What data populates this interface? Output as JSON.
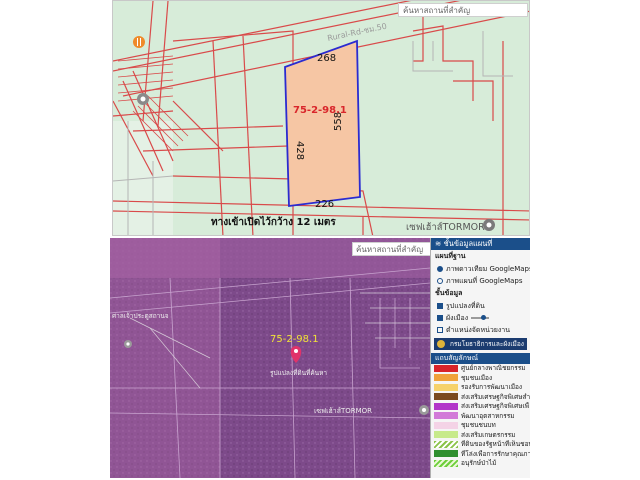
{
  "top_map": {
    "search_placeholder": "ค้นหาสถานที่สำคัญ",
    "road_label": "Rural-Rd-ชม.50",
    "parcel_id": "75-2-98.1",
    "side_top": "268",
    "side_left": "428",
    "side_right": "558",
    "side_bottom": "226",
    "access_note": "ทางเข้าเปิดไว้กว้าง 12 เมตร",
    "poi_label": "เซฟเฮ้าส์TORMOR",
    "colors": {
      "map_bg": "#d7ecd9",
      "parcel_fill": "#f6c6a4",
      "parcel_stroke": "#2b2bd0",
      "road_line": "#d94a4a"
    }
  },
  "bottom_map": {
    "search_placeholder": "ค้นหาสถานที่สำคัญ",
    "parcel_id": "75-2-98.1",
    "pin_label": "รูปแปลงที่ดินที่ค้นหา",
    "poi_label": "เซฟเฮ้าส์TORMOR",
    "left_poi_label": "ศาลเจ้าประตูสถานจ"
  },
  "panel": {
    "header": "ชั้นข้อมูลแผนที่",
    "basemap_title": "แผนที่ฐาน",
    "basemap_options": [
      "ภาพดาวเทียม GoogleMaps",
      "ภาพแผนที่ GoogleMaps"
    ],
    "layers_title": "ชั้นข้อมูล",
    "layers": [
      "รูปแปลงที่ดิน",
      "ผังเมือง",
      "ตำแหน่งจัดหน่วยงาน"
    ],
    "org_name": "กรมโยธาธิการและผังเมือง",
    "legend_title": "แถบสัญลักษณ์",
    "legend": [
      {
        "label": "ศูนย์กลางพาณิชยกรรม",
        "color": "#d8232a"
      },
      {
        "label": "ชุมชนเมือง",
        "color": "#f0a23a"
      },
      {
        "label": "รองรับการพัฒนาเมือง",
        "color": "#f6d26b"
      },
      {
        "label": "ส่งเสริมเศรษฐกิจพิเศษสำห",
        "color": "#7b4a1e"
      },
      {
        "label": "ส่งเสริมเศรษฐกิจพิเศษเพื่",
        "color": "#b235c9"
      },
      {
        "label": "พัฒนาอุตสาหกรรม",
        "color": "#d27ad8"
      },
      {
        "label": "ชุมชนชนบท",
        "color": "#f4d3e6"
      },
      {
        "label": "ส่งเสริมเกษตรกรรม",
        "color": "#c7ea8b"
      },
      {
        "label": "ที่ดินของรัฐหน้าที่เห็นชอบให้เป",
        "color": "hatch-green"
      },
      {
        "label": "ที่โล่งเพื่อการรักษาคุณภาพสิ่งแ",
        "color": "#2f8f2f"
      },
      {
        "label": "อนุรักษ์ป่าไม้",
        "color": "hatch-lime"
      }
    ]
  }
}
